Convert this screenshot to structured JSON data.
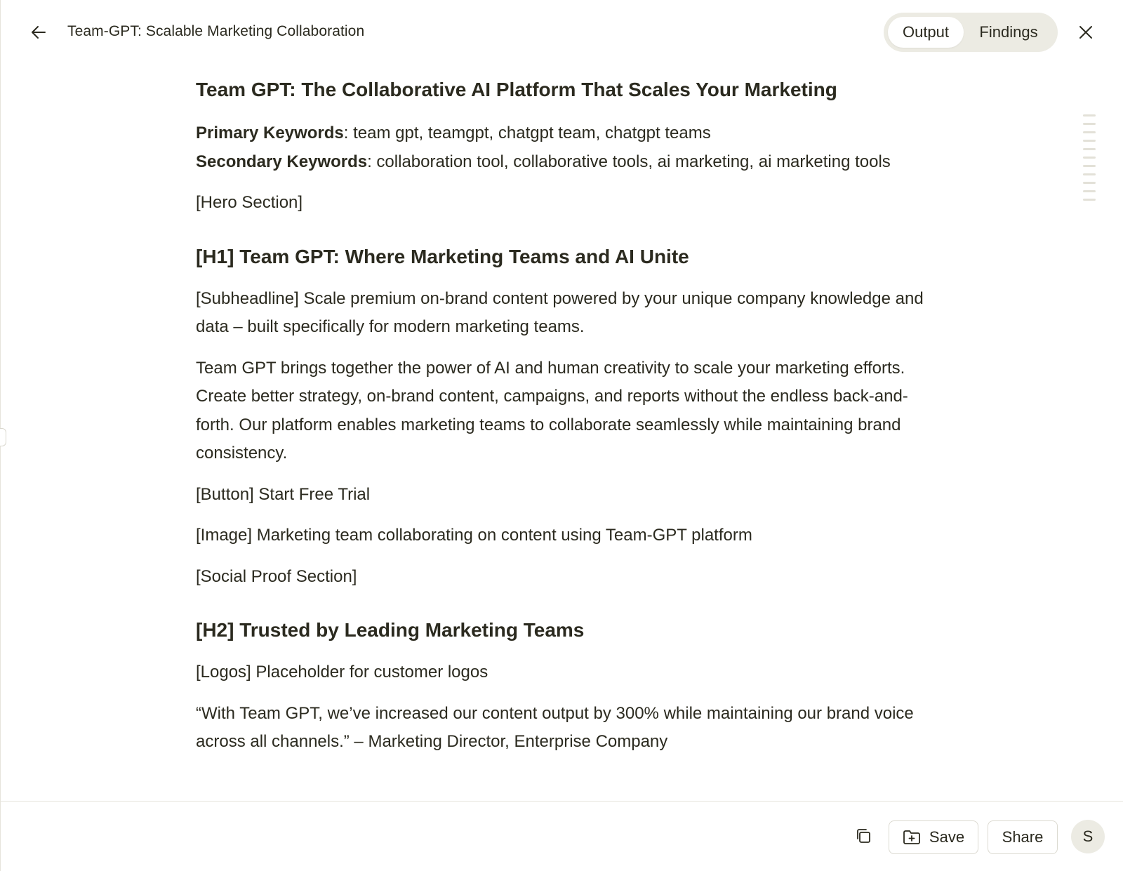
{
  "header": {
    "title": "Team-GPT: Scalable Marketing Collaboration",
    "tabs": [
      {
        "label": "Output",
        "active": true
      },
      {
        "label": "Findings",
        "active": false
      }
    ]
  },
  "document": {
    "heading": "Team GPT: The Collaborative AI Platform That Scales Your Marketing",
    "primary_keywords_label": "Primary Keywords",
    "primary_keywords": ": team gpt, teamgpt, chatgpt team, chatgpt teams",
    "secondary_keywords_label": "Secondary Keywords",
    "secondary_keywords": ": collaboration tool, collaborative tools, ai marketing, ai marketing tools",
    "hero_section": "[Hero Section]",
    "h1": "[H1] Team GPT: Where Marketing Teams and AI Unite",
    "subheadline": "[Subheadline] Scale premium on-brand content powered by your unique company knowledge and data – built specifically for modern marketing teams.",
    "body_paragraph": "Team GPT brings together the power of AI and human creativity to scale your marketing efforts. Create better strategy, on-brand content, campaigns, and reports without the endless back-and-forth. Our platform enables marketing teams to collaborate seamlessly while maintaining brand consistency.",
    "button_line": "[Button] Start Free Trial",
    "image_line": "[Image] Marketing team collaborating on content using Team-GPT platform",
    "social_proof_section": "[Social Proof Section]",
    "h2": "[H2] Trusted by Leading Marketing Teams",
    "logos_line": "[Logos] Placeholder for customer logos",
    "testimonial": "“With Team GPT, we’ve increased our content output by 300% while maintaining our brand voice across all channels.” – Marketing Director, Enterprise Company"
  },
  "footer": {
    "save_label": "Save",
    "share_label": "Share",
    "avatar_initial": "S"
  },
  "colors": {
    "text": "#2b2a1f",
    "toggle_bg": "#ecebe3",
    "border": "#dcdad1"
  },
  "icons": [
    "arrow-left-icon",
    "close-icon",
    "copy-icon",
    "folder-plus-icon"
  ]
}
